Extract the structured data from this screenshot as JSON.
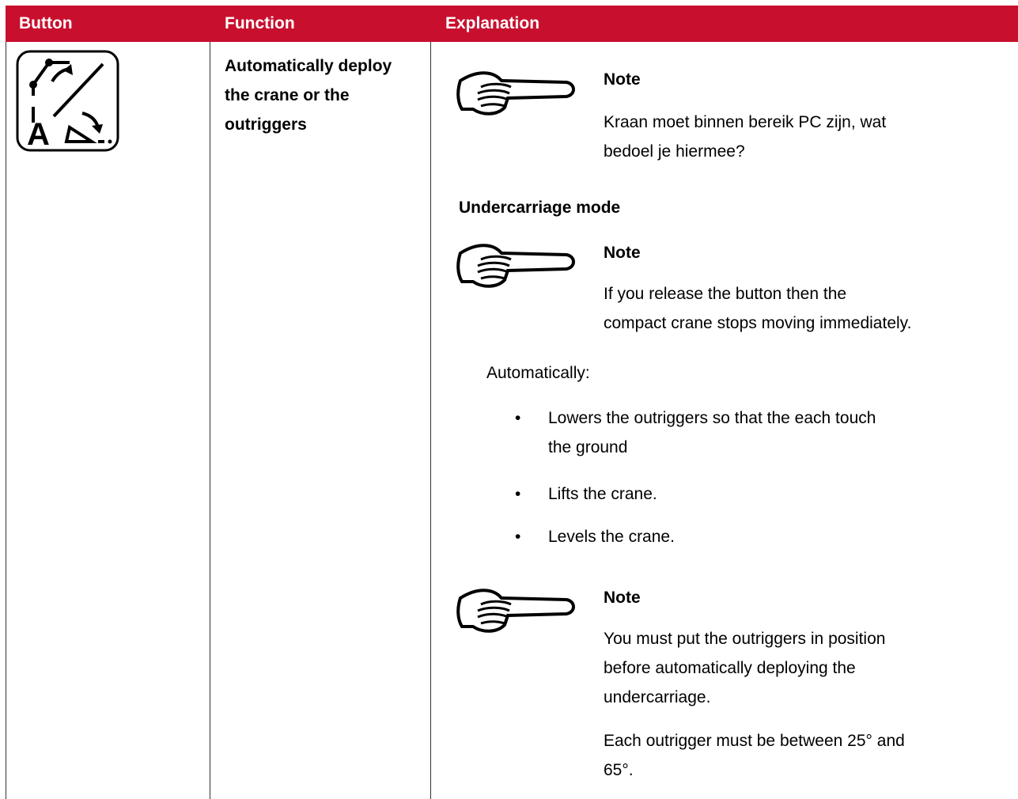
{
  "header": {
    "col_button": "Button",
    "col_function": "Function",
    "col_explanation": "Explanation"
  },
  "row": {
    "function_text_lines": [
      "Automatically deploy",
      "the crane or the",
      "outriggers"
    ],
    "note1": {
      "title": "Note",
      "lines": [
        "Kraan moet binnen bereik PC zijn, wat",
        "bedoel je hiermee?"
      ]
    },
    "section_heading": "Undercarriage mode",
    "note2": {
      "title": "Note",
      "lines": [
        "If you release the button then the",
        "compact crane stops moving immediately."
      ]
    },
    "automatically_label": "Automatically:",
    "bullets": [
      [
        "Lowers the outriggers so that the each touch",
        "the ground"
      ],
      [
        "Lifts the crane."
      ],
      [
        "Levels the crane."
      ]
    ],
    "note3": {
      "title": "Note",
      "lines": [
        "You must put the outriggers in position",
        "before automatically deploying the",
        "undercarriage."
      ],
      "extra_lines": [
        "Each outrigger must be between 25° and",
        "65°."
      ]
    }
  },
  "colors": {
    "header_bg": "#c8102e",
    "header_text": "#ffffff"
  },
  "icons": {
    "button_icon": "auto-deploy-icon",
    "note_icon": "pointing-hand-icon"
  }
}
